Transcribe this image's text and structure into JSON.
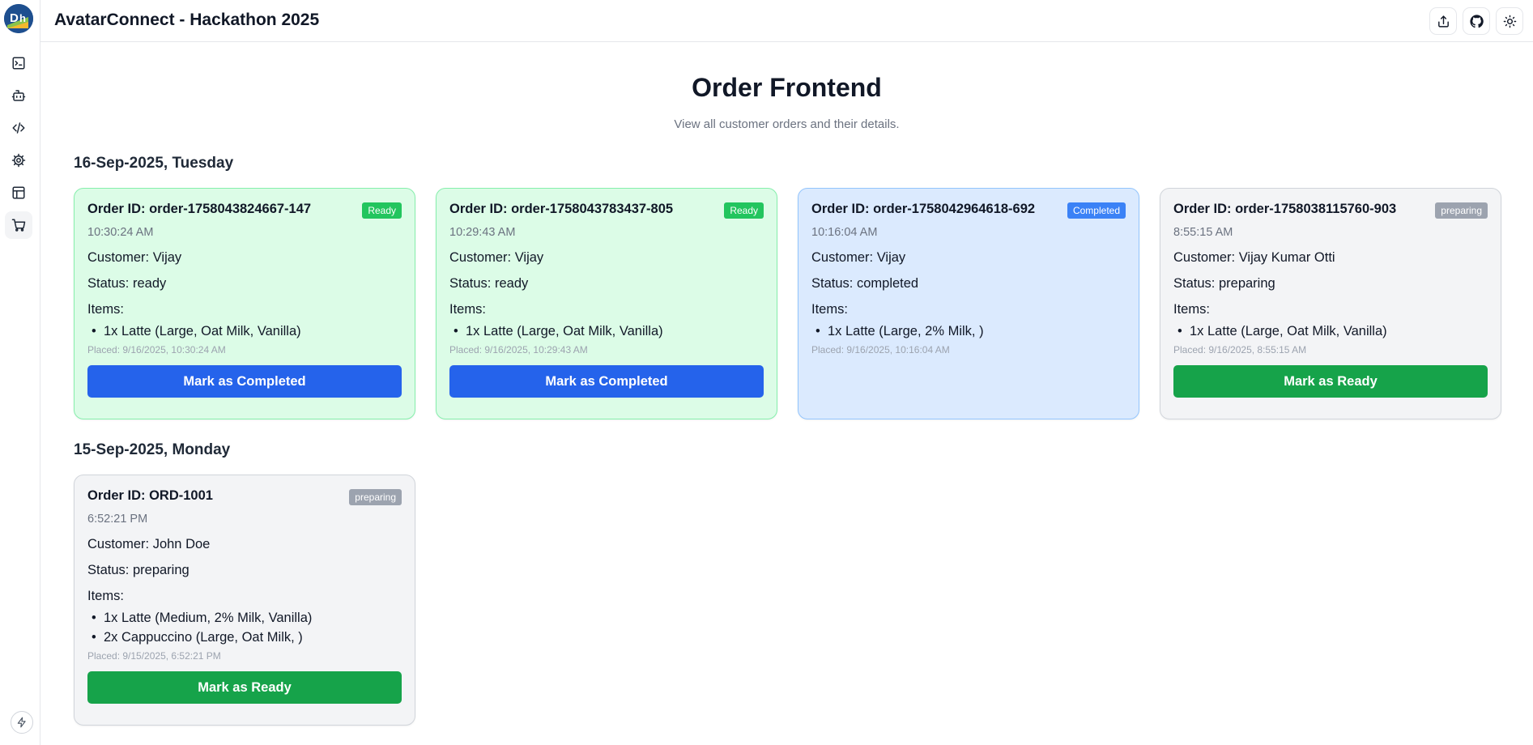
{
  "app": {
    "title": "AvatarConnect - Hackathon 2025"
  },
  "sidebar": {
    "items": [
      {
        "icon": "terminal-icon"
      },
      {
        "icon": "bot-icon"
      },
      {
        "icon": "code-icon"
      },
      {
        "icon": "gear-icon"
      },
      {
        "icon": "layout-icon"
      },
      {
        "icon": "cart-icon",
        "active": true
      }
    ],
    "bottom_icon": "bolt-icon"
  },
  "header_actions": [
    {
      "icon": "share-icon"
    },
    {
      "icon": "github-icon"
    },
    {
      "icon": "sun-icon"
    }
  ],
  "page": {
    "title": "Order Frontend",
    "subtitle": "View all customer orders and their details."
  },
  "labels": {
    "customer": "Customer:",
    "status": "Status:",
    "items": "Items:"
  },
  "groups": [
    {
      "date": "16-Sep-2025, Tuesday",
      "orders": [
        {
          "order_id": "Order ID: order-1758043824667-147",
          "badge": "Ready",
          "time": "10:30:24 AM",
          "customer": "Vijay",
          "status": "ready",
          "items": [
            "1x Latte (Large, Oat Milk, Vanilla)"
          ],
          "placed": "Placed: 9/16/2025, 10:30:24 AM",
          "action": "Mark as Completed"
        },
        {
          "order_id": "Order ID: order-1758043783437-805",
          "badge": "Ready",
          "time": "10:29:43 AM",
          "customer": "Vijay",
          "status": "ready",
          "items": [
            "1x Latte (Large, Oat Milk, Vanilla)"
          ],
          "placed": "Placed: 9/16/2025, 10:29:43 AM",
          "action": "Mark as Completed"
        },
        {
          "order_id": "Order ID: order-1758042964618-692",
          "badge": "Completed",
          "time": "10:16:04 AM",
          "customer": "Vijay",
          "status": "completed",
          "items": [
            "1x Latte (Large, 2% Milk, )"
          ],
          "placed": "Placed: 9/16/2025, 10:16:04 AM",
          "action": ""
        },
        {
          "order_id": "Order ID: order-1758038115760-903",
          "badge": "preparing",
          "time": "8:55:15 AM",
          "customer": "Vijay Kumar Otti",
          "status": "preparing",
          "items": [
            "1x Latte (Large, Oat Milk, Vanilla)"
          ],
          "placed": "Placed: 9/16/2025, 8:55:15 AM",
          "action": "Mark as Ready"
        }
      ]
    },
    {
      "date": "15-Sep-2025, Monday",
      "orders": [
        {
          "order_id": "Order ID: ORD-1001",
          "badge": "preparing",
          "time": "6:52:21 PM",
          "customer": "John Doe",
          "status": "preparing",
          "items": [
            "1x Latte (Medium, 2% Milk, Vanilla)",
            "2x Cappuccino (Large, Oat Milk, )"
          ],
          "placed": "Placed: 9/15/2025, 6:52:21 PM",
          "action": "Mark as Ready"
        }
      ]
    }
  ],
  "colors": {
    "ready_bg": "#dcfce7",
    "completed_bg": "#dbeafe",
    "preparing_bg": "#f3f4f6",
    "primary_blue": "#2563eb",
    "primary_green": "#16a34a"
  }
}
